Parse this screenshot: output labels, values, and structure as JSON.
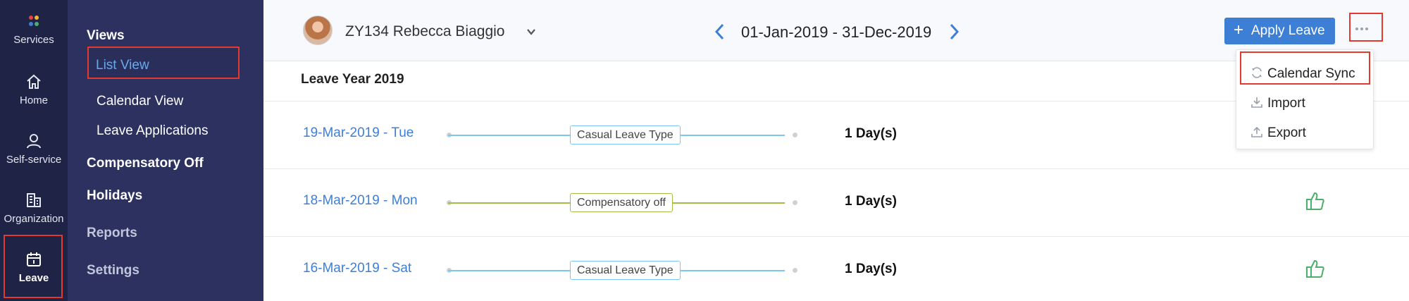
{
  "rail": {
    "items": [
      {
        "label": "Services",
        "icon": "services-icon"
      },
      {
        "label": "Home",
        "icon": "home-icon"
      },
      {
        "label": "Self-service",
        "icon": "person-icon"
      },
      {
        "label": "Organization",
        "icon": "building-icon"
      },
      {
        "label": "Leave",
        "icon": "calendar-icon",
        "active": true
      }
    ]
  },
  "menu": {
    "views_heading": "Views",
    "list_view": "List View",
    "calendar_view": "Calendar View",
    "leave_applications": "Leave Applications",
    "compensatory_off": "Compensatory Off",
    "holidays": "Holidays",
    "reports": "Reports",
    "settings": "Settings"
  },
  "header": {
    "user": "ZY134 Rebecca Biaggio",
    "date_range": "01-Jan-2019 - 31-Dec-2019",
    "apply_button": "Apply Leave",
    "more_icon": "more-dots-icon"
  },
  "leave_year_label": "Leave Year 2019",
  "leaves": [
    {
      "date": "19-Mar-2019 - Tue",
      "type": "Casual Leave Type",
      "color": "#7cc6f2",
      "days": "1 Day(s)",
      "approved_icon": false
    },
    {
      "date": "18-Mar-2019 - Mon",
      "type": "Compensatory off",
      "color": "#a3be45",
      "days": "1 Day(s)",
      "approved_icon": true
    },
    {
      "date": "16-Mar-2019 - Sat",
      "type": "Casual Leave Type",
      "color": "#7cc6f2",
      "days": "1 Day(s)",
      "approved_icon": true
    }
  ],
  "dropdown": {
    "items": [
      {
        "label": "Calendar Sync",
        "icon": "sync-icon"
      },
      {
        "label": "Import",
        "icon": "import-icon"
      },
      {
        "label": "Export",
        "icon": "export-icon"
      }
    ]
  },
  "colors": {
    "rail_bg": "#1f2346",
    "menu_bg": "#2c3160",
    "accent": "#3e7fd6",
    "highlight": "#e23a2e",
    "approved": "#4caf6a"
  }
}
